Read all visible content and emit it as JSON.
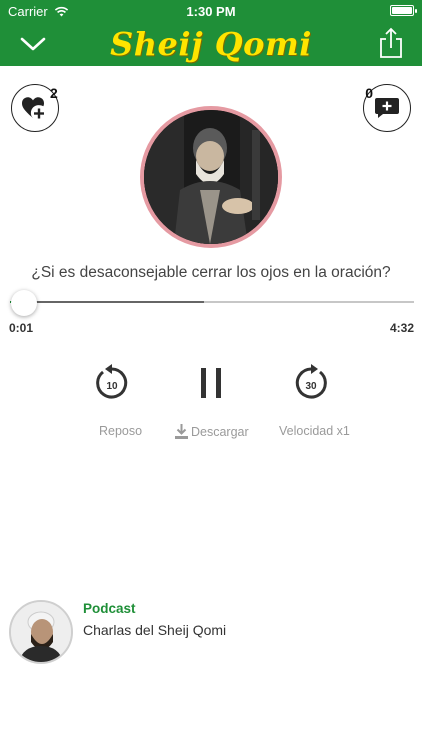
{
  "status_bar": {
    "carrier": "Carrier",
    "time": "1:30 PM"
  },
  "nav": {
    "title": "Sheij Qomi",
    "back_icon": "chevron-down-icon",
    "share_icon": "share-icon"
  },
  "likes": {
    "count": "2",
    "icon": "heart-plus-icon"
  },
  "comments": {
    "count": "0",
    "icon": "comment-plus-icon"
  },
  "track": {
    "title": "¿Si es desaconsejable cerrar los ojos en la oración?",
    "elapsed": "0:01",
    "total": "4:32",
    "played_fraction": 0.004,
    "buffered_fraction": 0.48
  },
  "controls": {
    "rewind_seconds": "10",
    "forward_seconds": "30"
  },
  "options": {
    "sleep": "Reposo",
    "download": "Descargar",
    "speed": "Velocidad x1"
  },
  "podcast": {
    "label": "Podcast",
    "name": "Charlas del Sheij Qomi"
  },
  "colors": {
    "brand_green": "#1f8f38",
    "title_yellow": "#ffe400",
    "artwork_ring": "#e59aa2"
  }
}
